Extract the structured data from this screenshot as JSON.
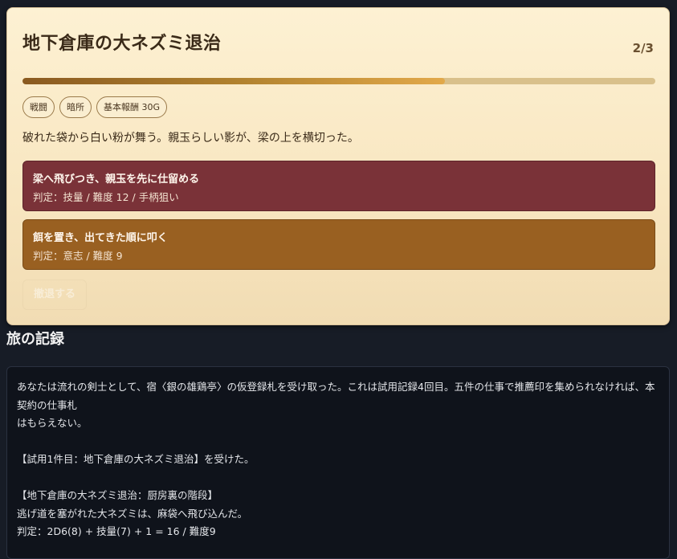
{
  "quest": {
    "title": "地下倉庫の大ネズミ退治",
    "progress_text": "2/3",
    "progress_fraction": 0.667,
    "tags": [
      "戦闘",
      "暗所",
      "基本報酬 30G"
    ],
    "description": "破れた袋から白い粉が舞う。親玉らしい影が、梁の上を横切った。",
    "choices": [
      {
        "title": "梁へ飛びつき、親玉を先に仕留める",
        "sub": "判定：技量 / 難度 12 / 手柄狙い",
        "color": "#7a3238"
      },
      {
        "title": "餌を置き、出てきた順に叩く",
        "sub": "判定：意志 / 難度 9",
        "color": "#996021"
      }
    ],
    "retreat_label": "撤退する"
  },
  "log": {
    "heading": "旅の記録",
    "entries": [
      "あなたは流れの剣士として、宿〈銀の雄鶏亭〉の仮登録札を受け取った。これは試用記録4回目。五件の仕事で推薦印を集められなければ、本契約の仕事札",
      "はもらえない。",
      "",
      "【試用1件目：地下倉庫の大ネズミ退治】を受けた。",
      "",
      "【地下倉庫の大ネズミ退治：厨房裏の階段】",
      "逃げ道を塞がれた大ネズミは、麻袋へ飛び込んだ。",
      "判定：2D6(8) + 技量(7) + 1 = 16 / 難度9"
    ]
  }
}
